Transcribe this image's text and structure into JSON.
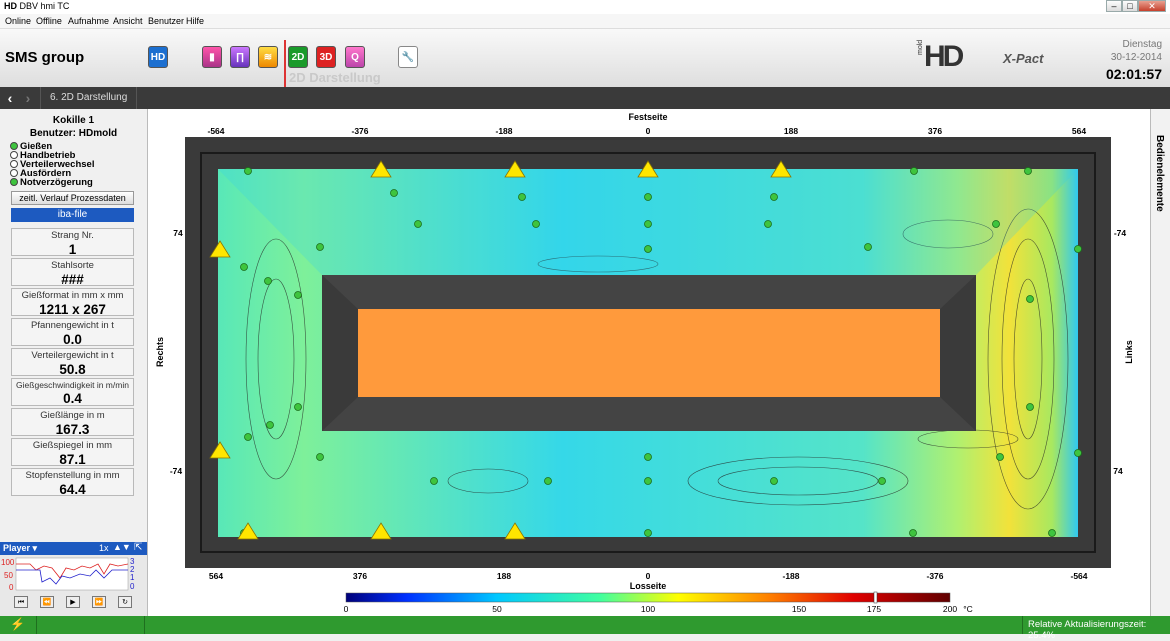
{
  "window": {
    "title": "DBV hmi TC",
    "app_icon": "HD"
  },
  "menu": [
    "Online",
    "Offline",
    "Aufnahme",
    "Ansicht",
    "Benutzer",
    "Hilfe"
  ],
  "header": {
    "brand": "SMS group",
    "toolbar_icons": [
      "hd-icon",
      "thermo-icon",
      "mold-icon",
      "flow-icon",
      "2d-icon",
      "3d-icon",
      "quality-icon",
      "wrench-icon"
    ],
    "toolbar_labels": {
      "hd": "HD",
      "d2": "2D",
      "d3": "3D",
      "q": "Q"
    },
    "active_view_label": "2D Darstellung",
    "mold_logo": "HD",
    "mold_logo_small": "mold",
    "xpact_logo": "X-Pact",
    "day": "Dienstag",
    "date": "30-12-2014",
    "time": "02:01:57"
  },
  "breadcrumb": "6. 2D Darstellung",
  "left": {
    "mold": "Kokille 1",
    "user": "Benutzer: HDmold",
    "status_items": [
      {
        "label": "Gießen",
        "active": true
      },
      {
        "label": "Handbetrieb",
        "active": false
      },
      {
        "label": "Verteilerwechsel",
        "active": false
      },
      {
        "label": "Ausfördern",
        "active": false
      },
      {
        "label": "Notverzögerung",
        "active": true
      }
    ],
    "process_button": "zeitl. Verlauf Prozessdaten",
    "iba_button": "iba-file",
    "values": [
      {
        "label": "Strang Nr.",
        "value": "1"
      },
      {
        "label": "Stahlsorte",
        "value": "###"
      },
      {
        "label": "Gießformat in mm x mm",
        "value": "1211 x 267"
      },
      {
        "label": "Pfannengewicht in t",
        "value": "0.0"
      },
      {
        "label": "Verteilergewicht in t",
        "value": "50.8"
      },
      {
        "label": "Gießgeschwindigkeit in m/min",
        "value": "0.4"
      },
      {
        "label": "Gießlänge in m",
        "value": "167.3"
      },
      {
        "label": "Gießspiegel in mm",
        "value": "87.1"
      },
      {
        "label": "Stopfenstellung in mm",
        "value": "64.4"
      }
    ]
  },
  "player": {
    "label": "Player",
    "speed": "1x",
    "y_ticks_left": [
      "100",
      "50",
      "0"
    ],
    "y_ticks_right": [
      "3",
      "2",
      "1",
      "0"
    ]
  },
  "plot": {
    "top_title": "Festseite",
    "bottom_title": "Losseite",
    "left_title": "Rechts",
    "right_title": "Links",
    "top_ticks": [
      "-564",
      "-376",
      "-188",
      "0",
      "188",
      "376",
      "564"
    ],
    "bottom_ticks": [
      "564",
      "376",
      "188",
      "0",
      "-188",
      "-376",
      "-564"
    ],
    "left_ticks": [
      "74",
      "-74"
    ],
    "right_ticks": [
      "-74",
      "74"
    ],
    "colorbar_ticks": [
      "0",
      "50",
      "100",
      "150",
      "175",
      "200"
    ],
    "colorbar_unit": "°C",
    "colors": {
      "frame": "#3a3a3a",
      "core": "#ff9a3c",
      "cool": "#2bd3f0",
      "mid": "#6fe6a0",
      "warm": "#f2e23a"
    }
  },
  "side_tab": "Bedienelemente",
  "statusbar": {
    "text": "Relative Aktualisierungszeit: 25.4%"
  }
}
